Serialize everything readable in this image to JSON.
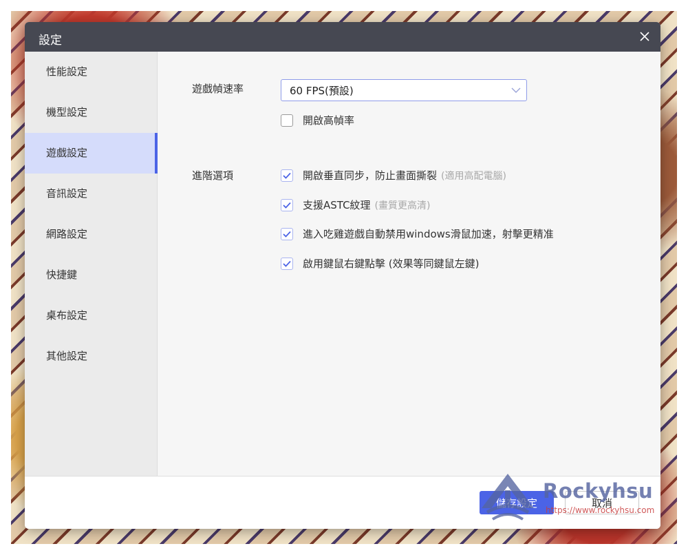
{
  "dialog": {
    "title": "設定"
  },
  "sidebar": {
    "items": [
      {
        "label": "性能設定"
      },
      {
        "label": "機型設定"
      },
      {
        "label": "遊戲設定",
        "active": true
      },
      {
        "label": "音訊設定"
      },
      {
        "label": "網路設定"
      },
      {
        "label": "快捷鍵"
      },
      {
        "label": "桌布設定"
      },
      {
        "label": "其他設定"
      }
    ]
  },
  "game_settings": {
    "fps_label": "遊戲幀速率",
    "fps_select": {
      "selected": "60 FPS(預設)"
    },
    "high_fps": {
      "label": "開啟高幀率",
      "checked": false
    },
    "advanced_label": "進階選項",
    "advanced_options": [
      {
        "label": "開啟垂直同步，防止畫面撕裂",
        "hint": "(適用高配電腦)",
        "checked": true
      },
      {
        "label": "支援ASTC紋理",
        "hint": "(畫質更高清)",
        "checked": true
      },
      {
        "label": "進入吃雞遊戲自動禁用windows滑鼠加速，射擊更精准",
        "hint": "",
        "checked": true
      },
      {
        "label": "啟用鍵鼠右鍵點擊 (效果等同鍵鼠左鍵)",
        "hint": "",
        "checked": true
      }
    ]
  },
  "footer": {
    "save_label": "儲存設定",
    "cancel_label": "取消"
  },
  "watermark": {
    "name": "Rockyhsu",
    "url": "https://www.rockyhsu.com"
  },
  "colors": {
    "accent": "#4b63e6",
    "titlebar": "#464852",
    "active_nav_bg": "#d5dcfb"
  }
}
